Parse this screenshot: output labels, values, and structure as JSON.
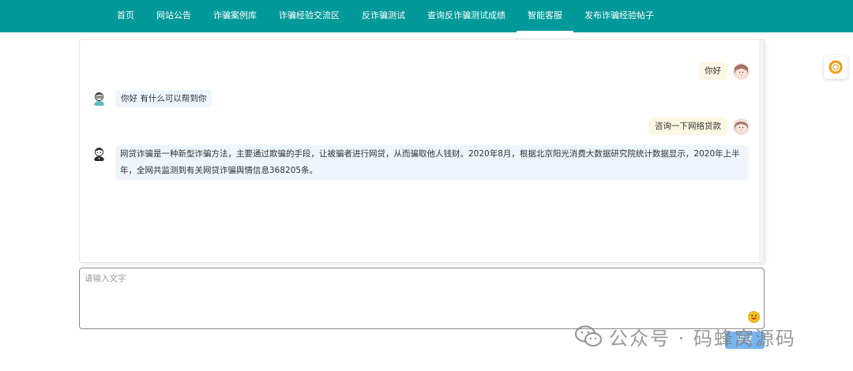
{
  "nav": {
    "items": [
      {
        "label": "首页",
        "active": false
      },
      {
        "label": "网站公告",
        "active": false
      },
      {
        "label": "诈骗案例库",
        "active": false
      },
      {
        "label": "诈骗经验交流区",
        "active": false
      },
      {
        "label": "反诈骗测试",
        "active": false
      },
      {
        "label": "查询反诈骗测试成绩",
        "active": false
      },
      {
        "label": "智能客服",
        "active": true
      },
      {
        "label": "发布诈骗经验帖子",
        "active": false
      }
    ]
  },
  "chat": {
    "messages": [
      {
        "role": "user",
        "text": "你好",
        "avatar_icon": "user-avatar-icon"
      },
      {
        "role": "bot",
        "text": "你好 有什么可以帮到你",
        "avatar_icon": "bot-avatar-icon"
      },
      {
        "role": "user",
        "text": "咨询一下网络贷款",
        "avatar_icon": "user-avatar-icon"
      },
      {
        "role": "bot",
        "text": "网贷诈骗是一种新型诈骗方法，主要通过欺骗的手段，让被骗者进行网贷，从而骗取他人钱财。2020年8月，根据北京阳光消费大数据研究院统计数据显示，2020年上半年，全网共监测到有关网贷诈骗舆情信息368205条。",
        "avatar_icon": "bot-avatar-icon"
      }
    ]
  },
  "input": {
    "placeholder": "请输入文字",
    "value": "",
    "emoji_icon": "emoji-icon"
  },
  "send": {
    "label": "发送"
  },
  "watermark": {
    "text": "公众号 · 码蜂窝源码"
  },
  "colors": {
    "nav_bg": "#009999",
    "user_bubble": "#fdf8e3",
    "bot_bubble": "#eef5fd",
    "send_button": "#79b4ee"
  }
}
